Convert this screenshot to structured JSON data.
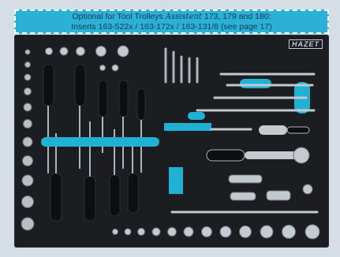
{
  "banner": {
    "line1_prefix": "Optional for Tool Trolleys",
    "line1_brand": "Assistent",
    "line1_suffix": "173, 179 and 180:",
    "line2": "Inserts 163-522x  / 163-172x  / 163-131/8  (see page 17)"
  },
  "tray": {
    "logo_text": "HAZET",
    "foam_color": "#1c1d20",
    "accent_color": "#1fb2d4"
  },
  "tools": {
    "screwdriver_count": 9,
    "socket_rows": 3
  }
}
